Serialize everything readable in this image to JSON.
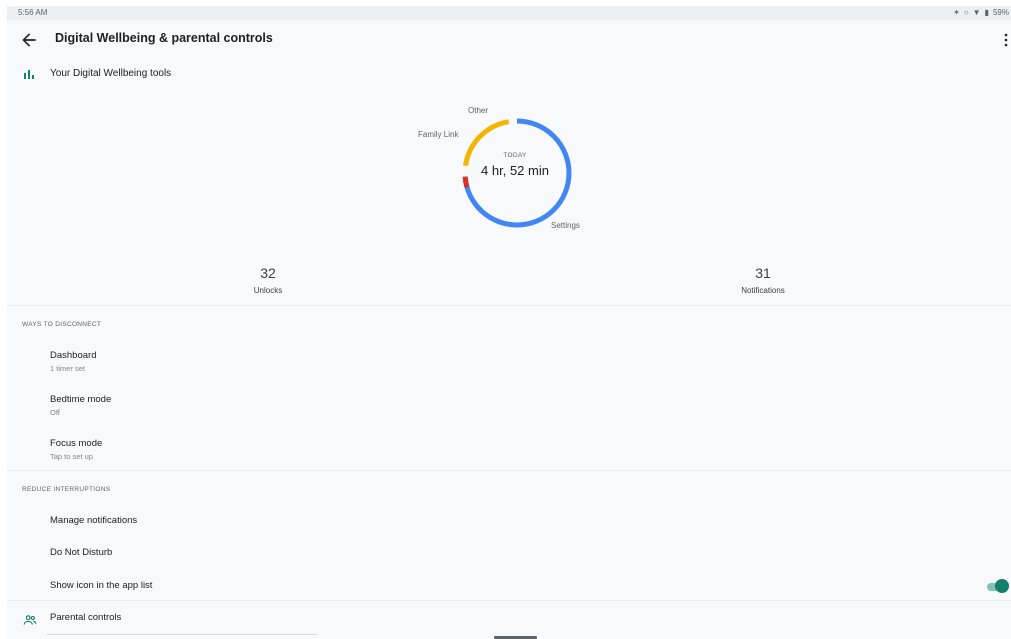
{
  "status_bar": {
    "time": "5:56 AM",
    "battery": "59%"
  },
  "app_bar": {
    "title": "Digital Wellbeing & parental controls",
    "back_icon": "arrow-back-icon",
    "more_icon": "more-vert-icon"
  },
  "tools": {
    "label": "Your Digital Wellbeing tools",
    "icon": "bar-chart-icon"
  },
  "usage_chart": {
    "today_label": "TODAY",
    "total_time": "4 hr, 52 min",
    "segments": [
      {
        "label": "Other",
        "color": "#f4b400"
      },
      {
        "label": "Family Link",
        "color": "#d93025"
      },
      {
        "label": "Settings",
        "color": "#4285f4"
      }
    ]
  },
  "stats": {
    "unlocks": {
      "value": "32",
      "label": "Unlocks"
    },
    "notifications": {
      "value": "31",
      "label": "Notifications"
    }
  },
  "ways_to_disconnect": {
    "header": "WAYS TO DISCONNECT",
    "items": [
      {
        "title": "Dashboard",
        "subtitle": "1 timer set"
      },
      {
        "title": "Bedtime mode",
        "subtitle": "Off"
      },
      {
        "title": "Focus mode",
        "subtitle": "Tap to set up"
      }
    ]
  },
  "reduce_interruptions": {
    "header": "REDUCE INTERRUPTIONS",
    "items": [
      {
        "title": "Manage notifications"
      },
      {
        "title": "Do Not Disturb"
      },
      {
        "title": "Show icon in the app list",
        "toggle_on": true
      }
    ]
  },
  "parental": {
    "title": "Parental controls",
    "icon": "supervisor-account-icon"
  },
  "colors": {
    "accent": "#12806c",
    "background": "#f8f9fa"
  }
}
